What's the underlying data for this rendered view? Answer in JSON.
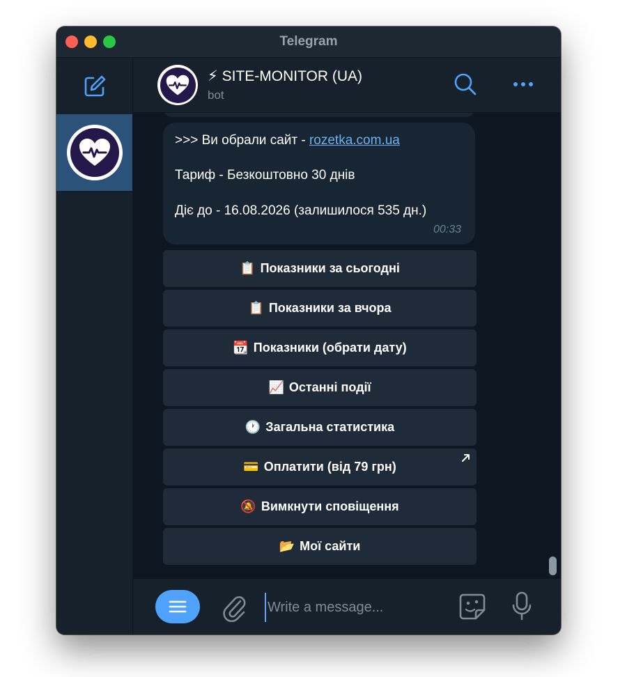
{
  "window": {
    "title": "Telegram"
  },
  "header": {
    "name": "⚡ SITE-MONITOR (UA)",
    "status": "bot"
  },
  "message": {
    "line1_prefix": ">>> Ви обрали сайт - ",
    "line1_link": "rozetka.com.ua",
    "line2": "Тариф - Безкоштовно 30 днів",
    "line3": "Діє до - 16.08.2026 (залишилося 535 дн.)",
    "time": "00:33"
  },
  "keyboard": [
    {
      "emoji": "📋",
      "label": "Показники за сьогодні"
    },
    {
      "emoji": "📋",
      "label": "Показники за вчора"
    },
    {
      "emoji": "📆",
      "label": "Показники (обрати дату)"
    },
    {
      "emoji": "📈",
      "label": "Останні події"
    },
    {
      "emoji": "🕐",
      "label": "Загальна статистика"
    },
    {
      "emoji": "💳",
      "label": "Оплатити (від 79 грн)"
    },
    {
      "emoji": "🔕",
      "label": "Вимкнути сповіщення"
    },
    {
      "emoji": "📂",
      "label": "Мої сайти"
    }
  ],
  "composer": {
    "placeholder": "Write a message..."
  },
  "icons": {
    "compose": "compose-icon",
    "search": "search-icon",
    "more": "more-icon",
    "menu": "menu-icon",
    "attach": "paperclip-icon",
    "sticker": "sticker-icon",
    "mic": "microphone-icon",
    "avatar": "heart-pulse-icon",
    "external": "external-link-icon"
  },
  "colors": {
    "accent": "#50a2ff",
    "link": "#6ab3f3",
    "selected_chat": "#2b5278",
    "bubble": "#182533",
    "keyboard_button": "#1f2b38"
  }
}
